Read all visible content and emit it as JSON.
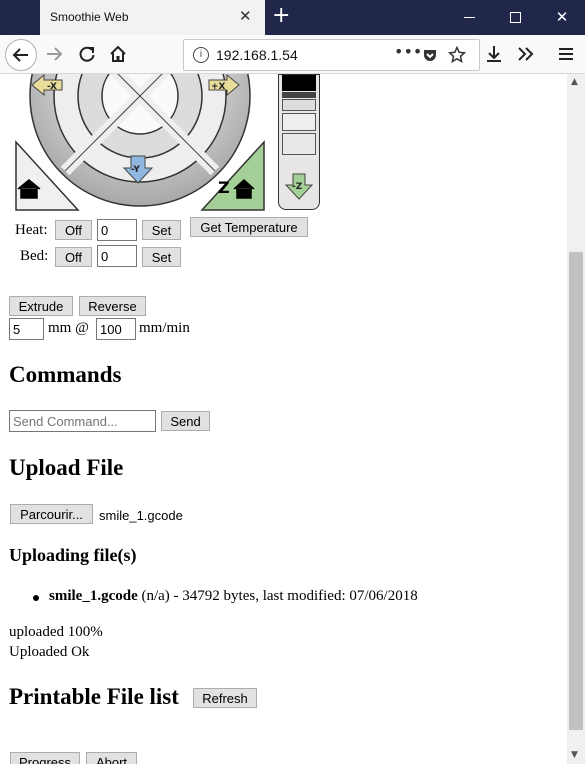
{
  "browser": {
    "tab_title": "Smoothie Web",
    "url": "192.168.1.54",
    "icons": [
      "back-icon",
      "forward-icon",
      "reload-icon",
      "home-icon",
      "info-icon",
      "more-icon",
      "pocket-icon",
      "star-icon",
      "download-icon",
      "overflow-icon",
      "menu-icon"
    ]
  },
  "jog": {
    "labels": [
      "-X",
      "+X",
      "-Y",
      "Z",
      "-Z"
    ]
  },
  "heat": {
    "label": "Heat:",
    "off": "Off",
    "value": "0",
    "set": "Set",
    "get_temp": "Get Temperature"
  },
  "bed": {
    "label": "Bed:",
    "off": "Off",
    "value": "0",
    "set": "Set"
  },
  "extrude": {
    "extrude_label": "Extrude",
    "reverse_label": "Reverse",
    "length_value": "5",
    "mm_at": "mm @",
    "speed_value": "100",
    "unit": "mm/min"
  },
  "commands": {
    "title": "Commands",
    "placeholder": "Send Command...",
    "send": "Send"
  },
  "upload": {
    "title": "Upload File",
    "browse": "Parcourir...",
    "filename": "smile_1.gcode",
    "uploading_title": "Uploading file(s)",
    "file_name": "smile_1.gcode",
    "file_details": " (n/a) - 34792 bytes, last modified: 07/06/2018",
    "progress": "uploaded 100%",
    "status": "Uploaded Ok"
  },
  "filelist": {
    "title": "Printable File list",
    "refresh": "Refresh"
  },
  "bottom": {
    "progress": "Progress",
    "abort": "Abort"
  }
}
